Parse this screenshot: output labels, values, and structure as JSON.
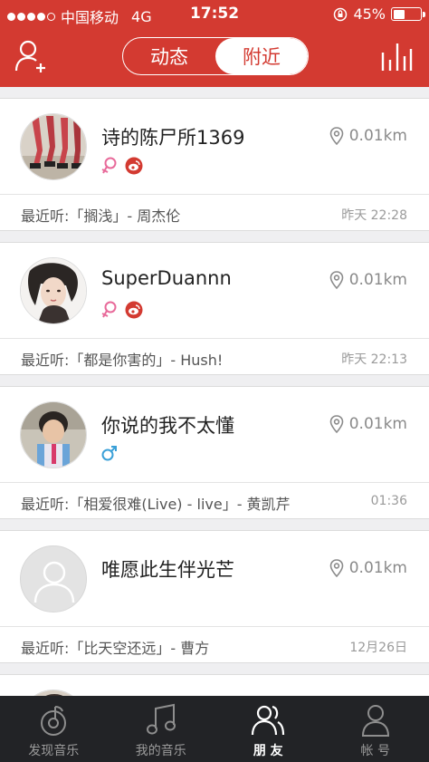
{
  "status_bar": {
    "carrier": "中国移动",
    "network": "4G",
    "time": "17:52",
    "battery": "45%",
    "battery_level": 0.45
  },
  "header": {
    "segments": [
      {
        "label": "动态",
        "active": false
      },
      {
        "label": "附近",
        "active": true
      }
    ]
  },
  "nearby_users": [
    {
      "name": "诗的陈尸所1369",
      "distance": "0.01km",
      "gender": "female",
      "weibo": true,
      "recent": "最近听:「搁浅」- 周杰伦",
      "time": "昨天 22:28"
    },
    {
      "name": "SuperDuannn",
      "distance": "0.01km",
      "gender": "female",
      "weibo": true,
      "recent": "最近听:「都是你害的」- Hush!",
      "time": "昨天 22:13"
    },
    {
      "name": "你说的我不太懂",
      "distance": "0.01km",
      "gender": "male",
      "weibo": false,
      "recent": "最近听:「相爱很难(Live) - live」- 黄凯芹",
      "time": "01:36"
    },
    {
      "name": "唯愿此生伴光芒",
      "distance": "0.01km",
      "gender": "",
      "weibo": false,
      "recent": "最近听:「比天空还远」- 曹方",
      "time": "12月26日"
    }
  ],
  "tabbar": {
    "tabs": [
      {
        "label": "发现音乐",
        "icon": "music-discover-icon",
        "active": false
      },
      {
        "label": "我的音乐",
        "icon": "music-note-icon",
        "active": false
      },
      {
        "label": "朋 友",
        "icon": "friends-icon",
        "active": true
      },
      {
        "label": "帐 号",
        "icon": "account-icon",
        "active": false
      }
    ]
  },
  "colors": {
    "brand_red": "#d33a31",
    "female_pink": "#e86a9a",
    "male_blue": "#3aa0d8",
    "tabbar_bg": "#222326"
  }
}
